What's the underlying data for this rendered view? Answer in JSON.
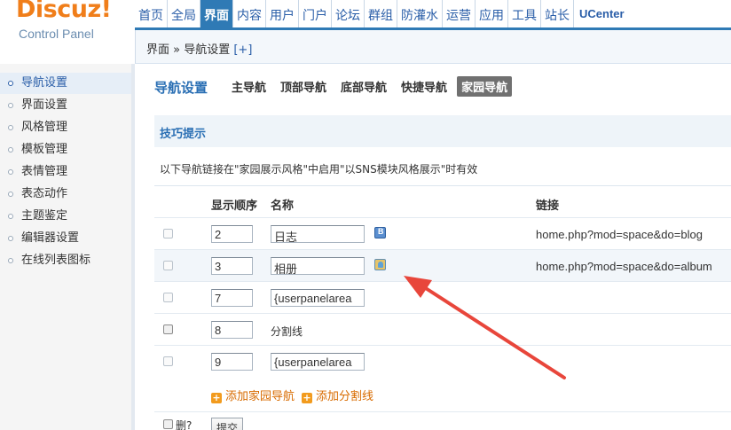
{
  "logo": {
    "brand": "Discuz!",
    "subtitle": "Control Panel"
  },
  "topnav": [
    "首页",
    "全局",
    "界面",
    "内容",
    "用户",
    "门户",
    "论坛",
    "群组",
    "防灌水",
    "运营",
    "应用",
    "工具",
    "站长",
    "UCenter"
  ],
  "breadcrumb": {
    "path": "界面 » 导航设置",
    "plus": "[+]"
  },
  "sidebar": [
    "导航设置",
    "界面设置",
    "风格管理",
    "模板管理",
    "表情管理",
    "表态动作",
    "主题鉴定",
    "编辑器设置",
    "在线列表图标"
  ],
  "main": {
    "title": "导航设置",
    "tabs": [
      "主导航",
      "顶部导航",
      "底部导航",
      "快捷导航",
      "家园导航"
    ],
    "active_tab": "家园导航",
    "tip_title": "技巧提示",
    "tip_text": "以下导航链接在\"家园展示风格\"中启用\"以SNS模块风格展示\"时有效",
    "headers": {
      "order": "显示顺序",
      "name": "名称",
      "link": "链接"
    },
    "rows": [
      {
        "order": "2",
        "name": "日志",
        "icon": "blog-icon",
        "link": "home.php?mod=space&do=blog"
      },
      {
        "order": "3",
        "name": "相册",
        "icon": "album-icon",
        "link": "home.php?mod=space&do=album"
      },
      {
        "order": "7",
        "name": "{userpanelarea",
        "icon": "",
        "link": ""
      },
      {
        "order": "8",
        "name": "分割线",
        "icon": "",
        "link": ""
      },
      {
        "order": "9",
        "name": "{userpanelarea",
        "icon": "",
        "link": ""
      }
    ],
    "add_home_nav": "添加家园导航",
    "add_divider": "添加分割线",
    "delete_label": "删?",
    "submit_label": "提交"
  },
  "colors": {
    "accent": "#2f7ab5",
    "brand": "#f07e1a",
    "arrow": "#e8463b"
  }
}
